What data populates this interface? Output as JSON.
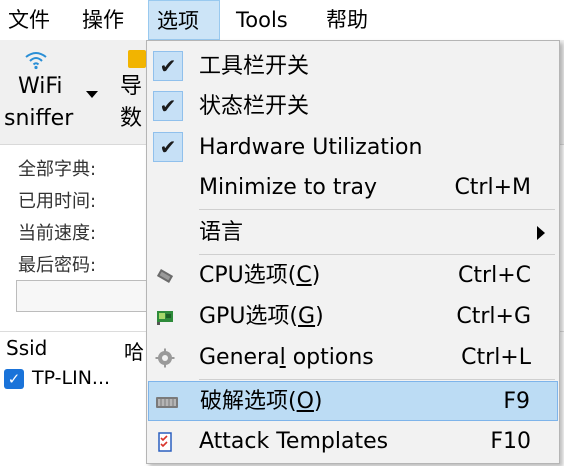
{
  "menubar": {
    "items": [
      "文件",
      "操作",
      "选项",
      "Tools",
      "帮助"
    ]
  },
  "toolbar": {
    "wifi_line1": "WiFi",
    "wifi_line2": "sniffer",
    "export_line1": "导",
    "export_line2": "数"
  },
  "stats": {
    "all_dict": "全部字典:",
    "elapsed": "已用时间:",
    "speed": "当前速度:",
    "last_pw": "最后密码:"
  },
  "table": {
    "col_ssid": "Ssid",
    "col_hash": "哈",
    "row1_ssid": "TP-LIN..."
  },
  "menu": {
    "items": [
      {
        "label": "工具栏开关",
        "checked": true,
        "shortcut": ""
      },
      {
        "label": "状态栏开关",
        "checked": true,
        "shortcut": ""
      },
      {
        "label": "Hardware Utilization",
        "checked": true,
        "shortcut": ""
      },
      {
        "label": "Minimize to tray",
        "checked": false,
        "shortcut": "Ctrl+M"
      },
      {
        "label": "语言",
        "submenu": true,
        "shortcut": ""
      },
      {
        "label_pre": "CPU选项(",
        "label_u": "C",
        "label_post": ")",
        "icon": "cpu-chip-icon",
        "shortcut": "Ctrl+C"
      },
      {
        "label_pre": "GPU选项(",
        "label_u": "G",
        "label_post": ")",
        "icon": "gpu-card-icon",
        "shortcut": "Ctrl+G"
      },
      {
        "label_pre": "Genera",
        "label_u": "l",
        "label_post": " options",
        "icon": "gear-icon",
        "shortcut": "Ctrl+L"
      },
      {
        "label_pre": "破解选项(",
        "label_u": "O",
        "label_post": ")",
        "icon": "keyboard-icon",
        "shortcut": "F9",
        "highlighted": true
      },
      {
        "label": "Attack Templates",
        "icon": "template-list-icon",
        "shortcut": "F10"
      }
    ]
  },
  "colors": {
    "menu_bg": "#f2f2f2",
    "highlight": "#bcdcf4",
    "check_bg": "#c6e0f6",
    "checkbox_blue": "#1a73d9"
  }
}
